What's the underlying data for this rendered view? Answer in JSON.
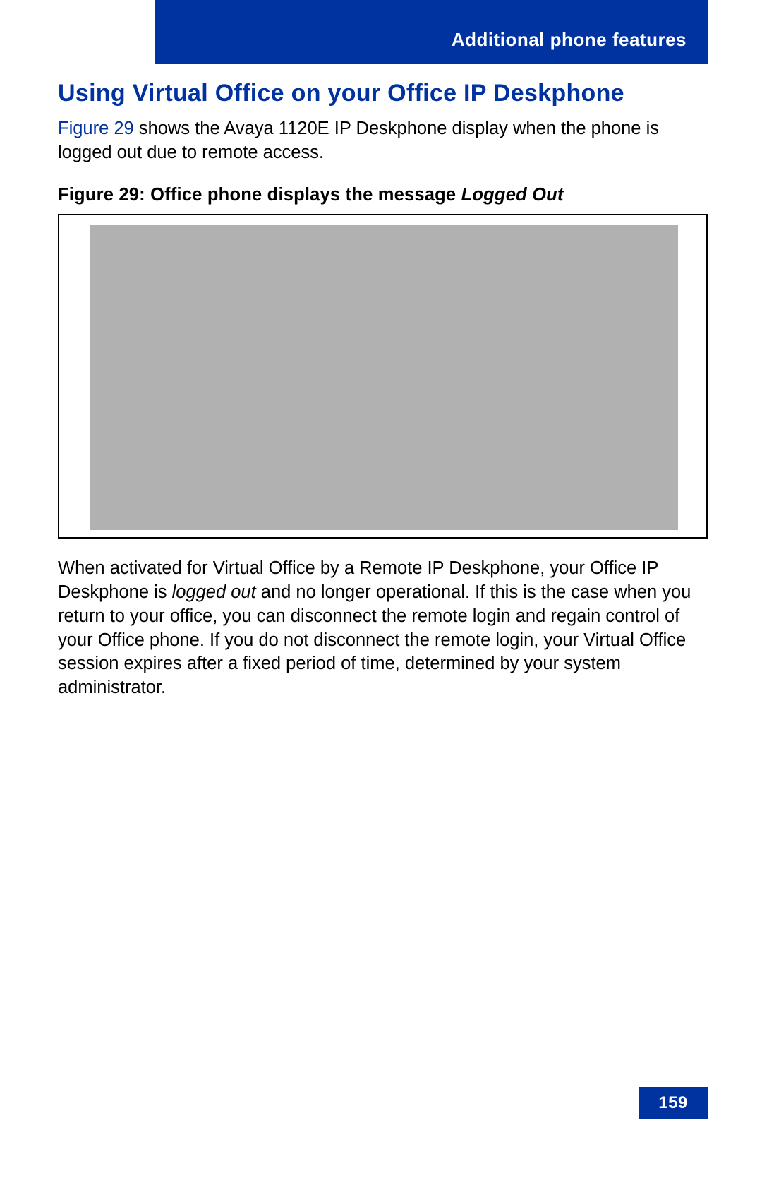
{
  "header": {
    "section": "Additional phone features"
  },
  "content": {
    "title": "Using Virtual Office on your Office IP Deskphone",
    "intro_ref": "Figure 29",
    "intro_rest": " shows the Avaya 1120E IP Deskphone display when the phone is logged out due to remote access.",
    "figure_caption_prefix": "Figure 29: Office phone displays the message ",
    "figure_caption_italic": "Logged Out",
    "body_p1_a": "When activated for Virtual Office by a Remote IP Deskphone, your Office IP Deskphone is ",
    "body_p1_italic": "logged out",
    "body_p1_b": " and no longer operational. If this is the case when you return to your office, you can disconnect the remote login and regain control of your Office phone. If you do not disconnect the remote login, your Virtual Office session expires after a fixed period of time, determined by your system administrator."
  },
  "footer": {
    "page_number": "159"
  }
}
